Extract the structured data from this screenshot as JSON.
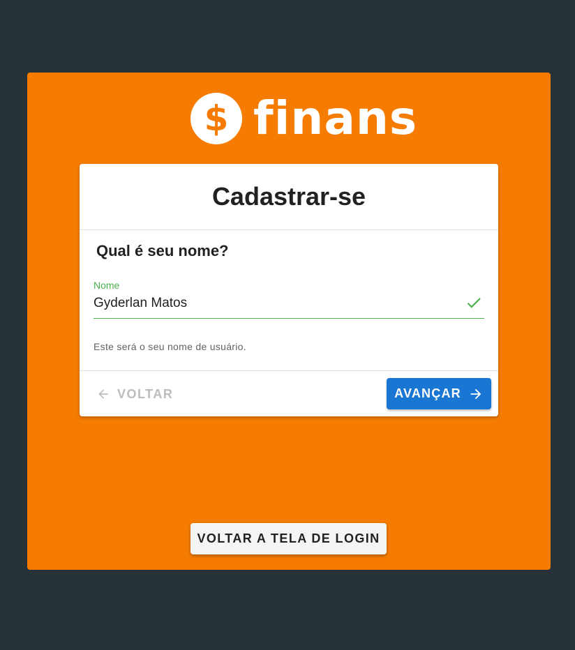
{
  "brand": {
    "logo_symbol": "$",
    "logo_text": "finans",
    "colors": {
      "background": "#263238",
      "panel": "#f57c00",
      "primary": "#1976d2",
      "success": "#4caf50"
    }
  },
  "card": {
    "title": "Cadastrar-se",
    "step_title": "Qual é seu nome?",
    "name_field": {
      "label": "Nome",
      "value": "Gyderlan Matos",
      "status_icon": "check-icon"
    },
    "hint": "Este será o seu nome de usuário.",
    "actions": {
      "back_label": "VOLTAR",
      "back_icon": "arrow-left-icon",
      "next_label": "AVANÇAR",
      "next_icon": "arrow-right-icon"
    }
  },
  "footer": {
    "login_button_label": "VOLTAR A TELA DE LOGIN"
  }
}
